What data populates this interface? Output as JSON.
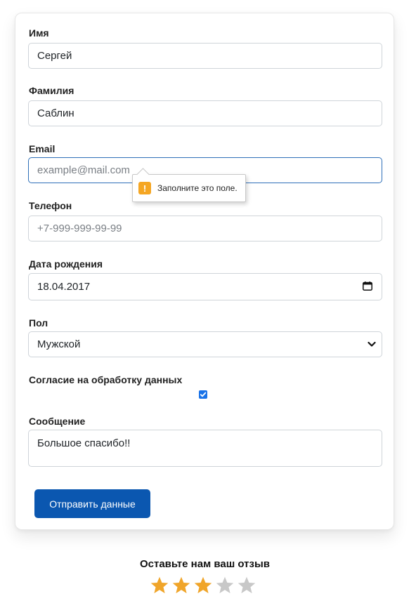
{
  "form": {
    "first_name": {
      "label": "Имя",
      "value": "Сергей"
    },
    "last_name": {
      "label": "Фамилия",
      "value": "Саблин"
    },
    "email": {
      "label": "Email",
      "placeholder": "example@mail.com"
    },
    "phone": {
      "label": "Телефон",
      "placeholder": "+7-999-999-99-99"
    },
    "birth_date": {
      "label": "Дата рождения",
      "value": "18.04.2017",
      "icon": "calendar-icon"
    },
    "gender": {
      "label": "Пол",
      "selected": "Мужской",
      "icon": "chevron-down-icon"
    },
    "consent": {
      "label": "Согласие на обработку данных",
      "checked": true
    },
    "message": {
      "label": "Сообщение",
      "value": "Большое спасибо!!"
    },
    "submit_label": "Отправить данные"
  },
  "validation_tooltip": {
    "icon_symbol": "!",
    "text": "Заполните это поле."
  },
  "review": {
    "title": "Оставьте нам ваш отзыв",
    "rating": 3,
    "max_rating": 5
  },
  "colors": {
    "primary": "#0b57b0",
    "focus_border": "#2e6fb8",
    "star_active": "#f0a52a",
    "star_inactive": "#c8c8c8",
    "warning": "#f5a623",
    "checkbox": "#1a73e8"
  }
}
